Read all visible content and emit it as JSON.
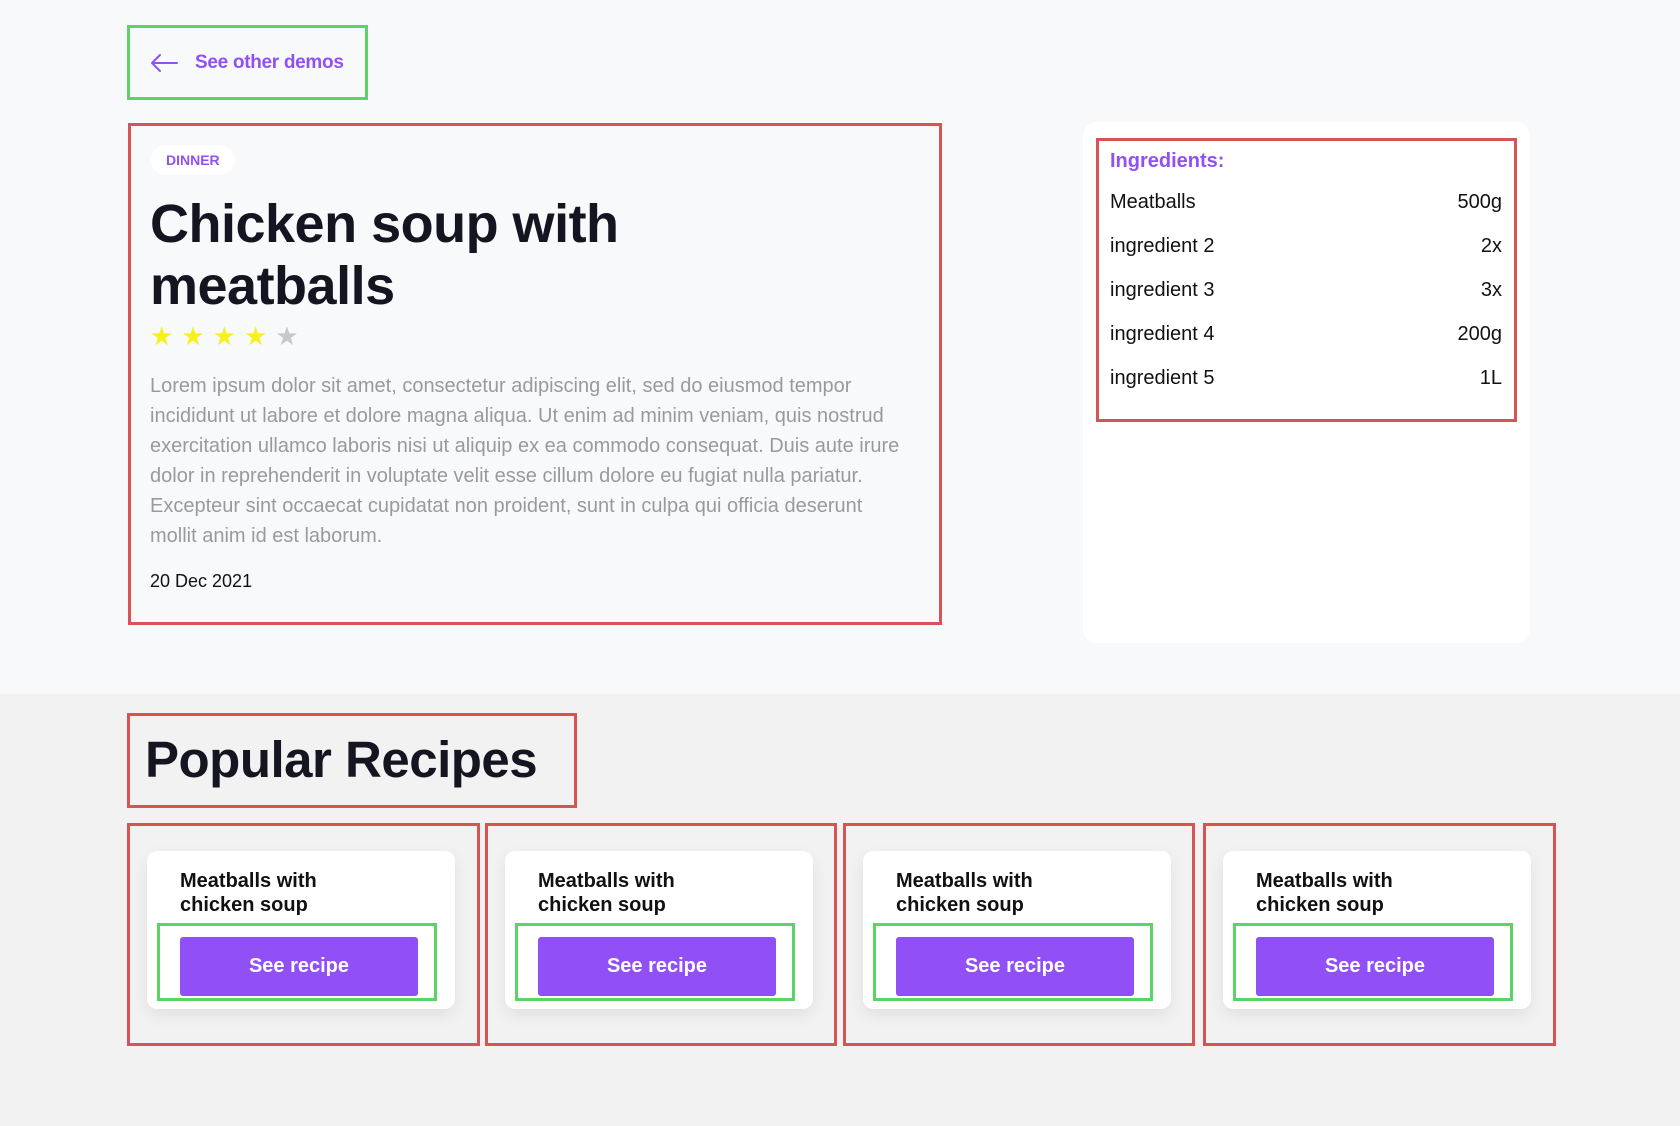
{
  "nav": {
    "back_label": "See other demos"
  },
  "recipe": {
    "category": "DINNER",
    "title": "Chicken soup with meatballs",
    "rating": 4,
    "rating_max": 5,
    "description": "Lorem ipsum dolor sit amet, consectetur adipiscing elit, sed do eiusmod tempor incididunt ut labore et dolore magna aliqua. Ut enim ad minim veniam, quis nostrud exercitation ullamco laboris nisi ut aliquip ex ea commodo consequat. Duis aute irure dolor in reprehenderit in voluptate velit esse cillum dolore eu fugiat nulla pariatur. Excepteur sint occaecat cupidatat non proident, sunt in culpa qui officia deserunt mollit anim id est laborum.",
    "date": "20 Dec 2021"
  },
  "ingredients": {
    "title": "Ingredients:",
    "items": [
      {
        "name": "Meatballs",
        "amount": "500g"
      },
      {
        "name": "ingredient 2",
        "amount": "2x"
      },
      {
        "name": "ingredient 3",
        "amount": "3x"
      },
      {
        "name": "ingredient 4",
        "amount": "200g"
      },
      {
        "name": "ingredient 5",
        "amount": "1L"
      }
    ]
  },
  "popular": {
    "title": "Popular Recipes",
    "cards": [
      {
        "title": "Meatballs with chicken soup",
        "button_label": "See recipe"
      },
      {
        "title": "Meatballs with chicken soup",
        "button_label": "See recipe"
      },
      {
        "title": "Meatballs with chicken soup",
        "button_label": "See recipe"
      },
      {
        "title": "Meatballs with chicken soup",
        "button_label": "See recipe"
      }
    ]
  },
  "colors": {
    "accent": "#9150f5",
    "star_filled": "#f7f01c",
    "star_empty": "#c8c8c8",
    "highlight_green": "#5ad565",
    "highlight_red": "#d85454"
  }
}
